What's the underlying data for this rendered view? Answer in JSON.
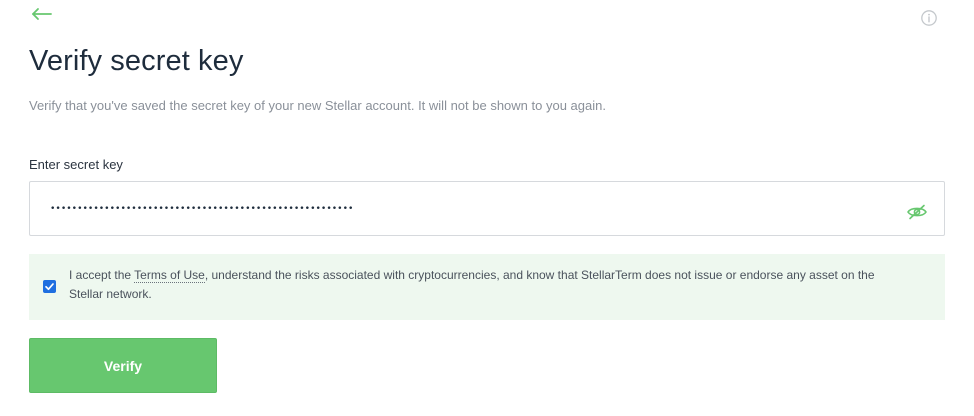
{
  "header": {
    "back_icon": "arrow-left-icon",
    "info_icon": "info-icon"
  },
  "page": {
    "title": "Verify secret key",
    "subtitle": "Verify that you've saved the secret key of your new Stellar account. It will not be shown to you again."
  },
  "secret_key": {
    "label": "Enter secret key",
    "value": "••••••••••••••••••••••••••••••••••••••••••••••••••••••••",
    "toggle_icon": "eye-off-icon"
  },
  "terms": {
    "checked": true,
    "prefix": "I accept the ",
    "link_text": "Terms of Use",
    "suffix": ", understand the risks associated with cryptocurrencies, and know that StellarTerm does not issue or endorse any asset on the Stellar network."
  },
  "actions": {
    "verify_label": "Verify"
  },
  "colors": {
    "accent_green": "#67c76f",
    "terms_background": "#eef8ef",
    "checkbox_blue": "#1f6fe0"
  }
}
